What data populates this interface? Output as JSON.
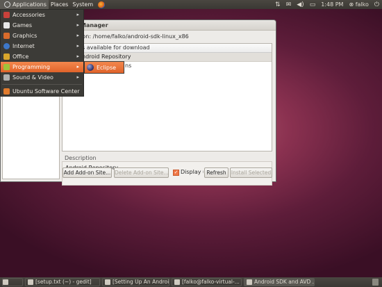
{
  "top_panel": {
    "menus": [
      "Applications",
      "Places",
      "System"
    ],
    "clock": "1:48 PM",
    "user": "falko"
  },
  "app_menu": {
    "items": [
      {
        "label": "Accessories",
        "icon": "accessories-icon",
        "color": "#c9413b"
      },
      {
        "label": "Games",
        "icon": "games-icon",
        "color": "#e8e8e8"
      },
      {
        "label": "Graphics",
        "icon": "graphics-icon",
        "color": "#d96b2b"
      },
      {
        "label": "Internet",
        "icon": "internet-icon",
        "color": "#3d77c8"
      },
      {
        "label": "Office",
        "icon": "office-icon",
        "color": "#d9a62b"
      },
      {
        "label": "Programming",
        "icon": "programming-icon",
        "color": "#9fc23a"
      },
      {
        "label": "Sound & Video",
        "icon": "sound-video-icon",
        "color": "#b0b0b0"
      },
      {
        "label": "Ubuntu Software Center",
        "icon": "software-center-icon",
        "color": "#e07b2d"
      }
    ],
    "highlighted": "Programming"
  },
  "submenu": {
    "label": "Eclipse"
  },
  "sdk_window": {
    "title": "Manager",
    "location": "tion: /home/falko/android-sdk-linux_x86",
    "list_header": "s available for download",
    "list_selected": "ndroid Repository",
    "list_row": "ns",
    "description_label": "Description",
    "description_text": "Android Repository",
    "buttons": {
      "add": "Add Add-on Site...",
      "delete": "Delete Add-on Site...",
      "display": "Display u",
      "refresh": "Refresh",
      "install": "Install Selected"
    }
  },
  "taskbar": {
    "tasks": [
      {
        "label": "[setup.txt (~) - gedit]",
        "active": false
      },
      {
        "label": "[Setting Up An Androi...",
        "active": false
      },
      {
        "label": "[falko@falko-virtual-...",
        "active": false
      },
      {
        "label": "Android SDK and AVD ...",
        "active": true
      }
    ]
  },
  "accent_color": "#f07746"
}
